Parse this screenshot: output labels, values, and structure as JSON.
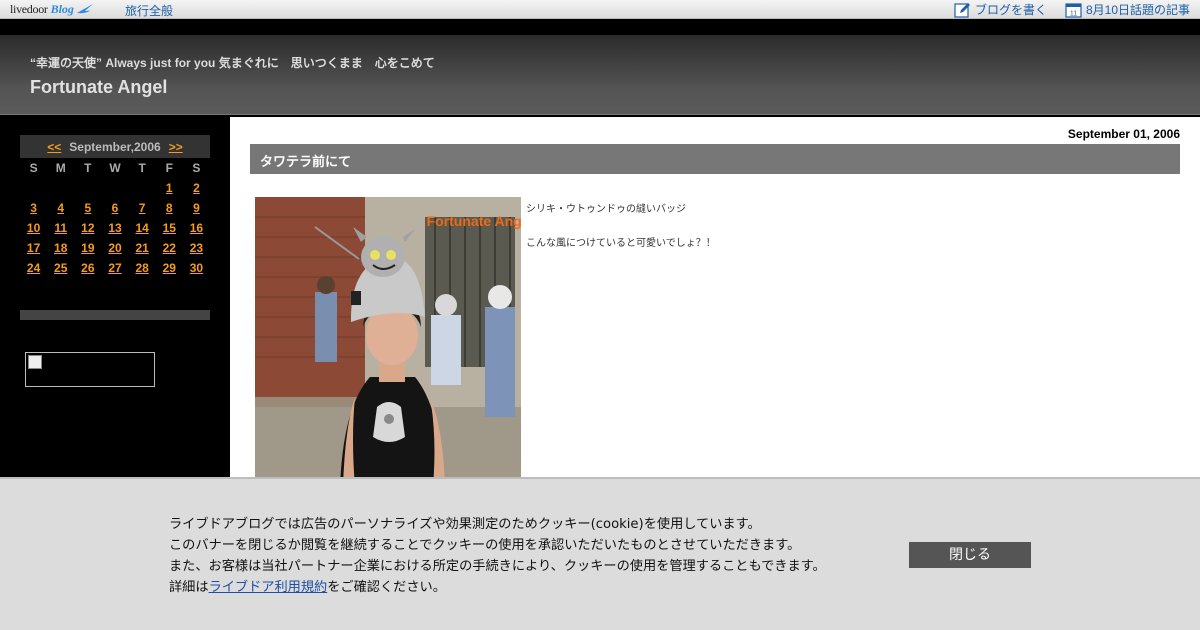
{
  "topbar": {
    "logo_text": "livedoor",
    "logo_blog": "Blog",
    "category": "旅行全般",
    "write_blog": "ブログを書く",
    "trending": "8月10日話題の記事",
    "calendar_icon_day": "11"
  },
  "header": {
    "tagline": "“幸運の天使” Always just for you 気まぐれに　思いつくまま　心をこめて",
    "title": "Fortunate Angel"
  },
  "calendar": {
    "prev": "<<",
    "next": ">>",
    "month": "September,2006",
    "weekdays": [
      "S",
      "M",
      "T",
      "W",
      "T",
      "F",
      "S"
    ],
    "days": [
      "1",
      "2",
      "3",
      "4",
      "5",
      "6",
      "7",
      "8",
      "9",
      "10",
      "11",
      "12",
      "13",
      "14",
      "15",
      "16",
      "17",
      "18",
      "19",
      "20",
      "21",
      "22",
      "23",
      "24",
      "25",
      "26",
      "27",
      "28",
      "29",
      "30"
    ]
  },
  "entry": {
    "date": "September 01, 2006",
    "title": "タワテラ前にて",
    "photo_watermark": "Fortunate Angel",
    "line1": "シリキ・ウトゥンドゥの縫いバッジ",
    "line2": "こんな風につけていると可愛いでしょ？！"
  },
  "cookie": {
    "line1": "ライブドアブログでは広告のパーソナライズや効果測定のためクッキー(cookie)を使用しています。",
    "line2": "このバナーを閉じるか閲覧を継続することでクッキーの使用を承認いただいたものとさせていただきます。",
    "line3": "また、お客様は当社パートナー企業における所定の手続きにより、クッキーの使用を管理することもできます。",
    "line4_prefix": "詳細は",
    "line4_link": "ライブドア利用規約",
    "line4_suffix": "をご確認ください。",
    "close_label": "閉じる"
  }
}
